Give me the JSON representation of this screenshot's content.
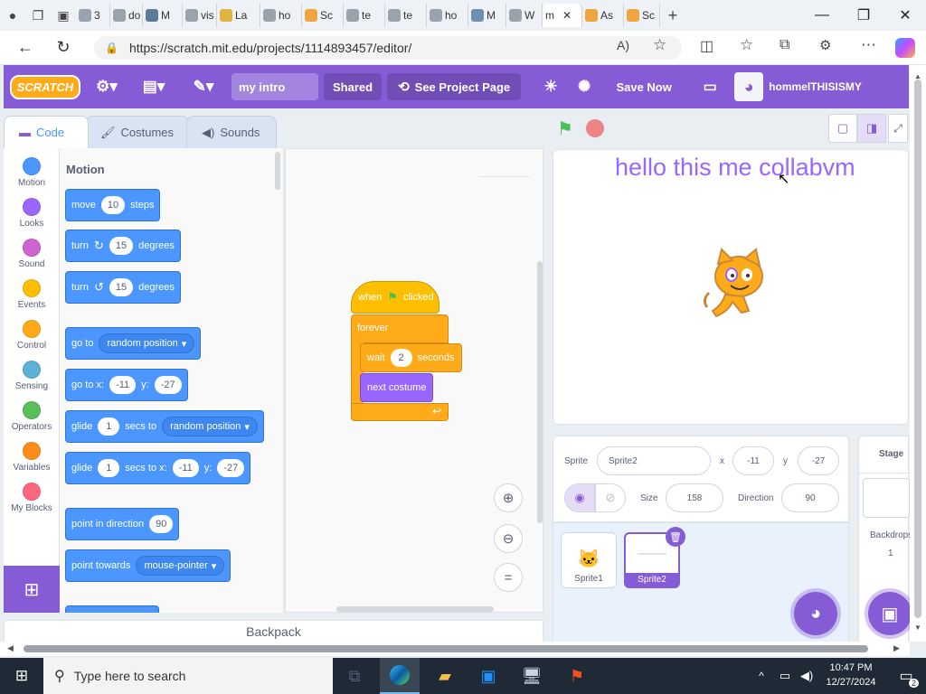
{
  "browser": {
    "tabs": [
      "3",
      "do",
      "M",
      "vis",
      "La",
      "ho",
      "Sc",
      "te",
      "te",
      "ho",
      "M",
      "W",
      "m",
      "As",
      "Sc"
    ],
    "url": "https://scratch.mit.edu/projects/1114893457/editor/"
  },
  "menu": {
    "logo": "SCRATCH",
    "project_title": "my intro",
    "shared_label": "Shared",
    "see_project_label": "See Project Page",
    "save_now_label": "Save Now",
    "username": "hommelTHISISMY"
  },
  "editor_tabs": [
    "Code",
    "Costumes",
    "Sounds"
  ],
  "categories": [
    {
      "label": "Motion",
      "color": "#4c97ff"
    },
    {
      "label": "Looks",
      "color": "#9966ff"
    },
    {
      "label": "Sound",
      "color": "#cf63cf"
    },
    {
      "label": "Events",
      "color": "#ffbf00"
    },
    {
      "label": "Control",
      "color": "#ffab19"
    },
    {
      "label": "Sensing",
      "color": "#5cb1d6"
    },
    {
      "label": "Operators",
      "color": "#59c059"
    },
    {
      "label": "Variables",
      "color": "#ff8c1a"
    },
    {
      "label": "My Blocks",
      "color": "#ff6680"
    }
  ],
  "palette": {
    "heading": "Motion",
    "move": {
      "a": "move",
      "n": "10",
      "b": "steps"
    },
    "turn_right": {
      "a": "turn",
      "n": "15",
      "b": "degrees"
    },
    "turn_left": {
      "a": "turn",
      "n": "15",
      "b": "degrees"
    },
    "goto": {
      "a": "go to",
      "dd": "random position"
    },
    "goto_xy": {
      "a": "go to x:",
      "x": "-11",
      "ylab": "y:",
      "y": "-27"
    },
    "glide": {
      "a": "glide",
      "n": "1",
      "b": "secs to",
      "dd": "random position"
    },
    "glide_xy": {
      "a": "glide",
      "n": "1",
      "b": "secs to x:",
      "x": "-11",
      "ylab": "y:",
      "y": "-27"
    },
    "point_dir": {
      "a": "point in direction",
      "n": "90"
    },
    "point_towards": {
      "a": "point towards",
      "dd": "mouse-pointer"
    }
  },
  "script": {
    "when_a": "when",
    "when_b": "clicked",
    "forever": "forever",
    "wait_a": "wait",
    "wait_n": "2",
    "wait_b": "seconds",
    "next_costume": "next costume"
  },
  "backpack": "Backpack",
  "stage": {
    "text": "hello this me collabvm"
  },
  "sprite_info": {
    "sprite_label": "Sprite",
    "sprite_name": "Sprite2",
    "x_label": "x",
    "x": "-11",
    "y_label": "y",
    "y": "-27",
    "size_label": "Size",
    "size": "158",
    "direction_label": "Direction",
    "direction": "90"
  },
  "sprites": [
    "Sprite1",
    "Sprite2"
  ],
  "stage_panel": {
    "title": "Stage",
    "backdrops_label": "Backdrops",
    "backdrops_count": "1"
  },
  "taskbar": {
    "search_placeholder": "Type here to search",
    "time": "10:47 PM",
    "date": "12/27/2024",
    "notif_count": "2"
  }
}
